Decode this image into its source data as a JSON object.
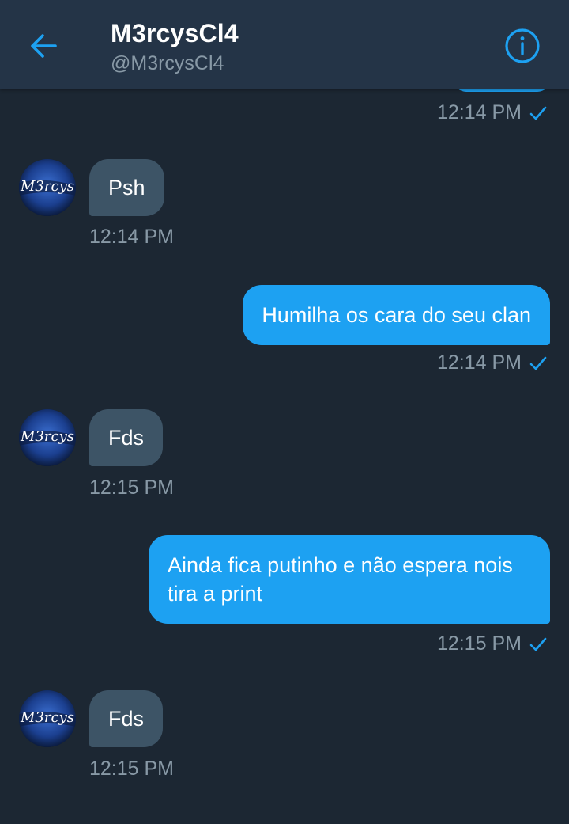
{
  "header": {
    "title": "M3rcysCl4",
    "handle": "@M3rcysCl4"
  },
  "avatar": {
    "text": "M3rcys"
  },
  "messages": [
    {
      "direction": "out",
      "text": "",
      "time": "12:14 PM"
    },
    {
      "direction": "in",
      "text": "Psh",
      "time": "12:14 PM"
    },
    {
      "direction": "out",
      "text": "Humilha os cara do seu clan",
      "time": "12:14 PM"
    },
    {
      "direction": "in",
      "text": "Fds",
      "time": "12:15 PM"
    },
    {
      "direction": "out",
      "text": "Ainda fica putinho e não espera nois tira a print",
      "time": "12:15 PM"
    },
    {
      "direction": "in",
      "text": "Fds",
      "time": "12:15 PM"
    }
  ],
  "colors": {
    "background": "#1c2733",
    "header": "#243447",
    "accent": "#1da1f2",
    "incoming_bubble": "#3d5466",
    "muted_text": "#8899a6"
  },
  "icons": {
    "back": "arrow-left-icon",
    "info": "info-circle-icon",
    "read_receipt": "check-icon"
  }
}
